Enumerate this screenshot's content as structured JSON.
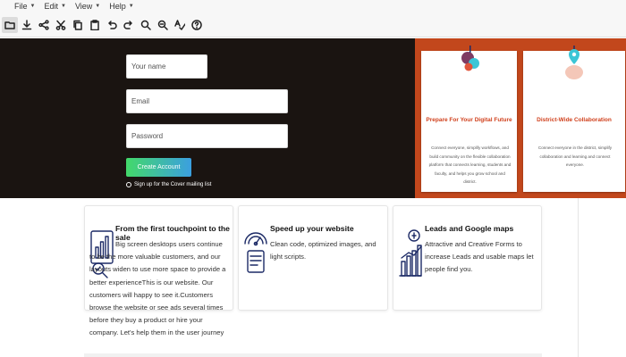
{
  "menubar": {
    "items": [
      {
        "label": "File"
      },
      {
        "label": "Edit"
      },
      {
        "label": "View"
      },
      {
        "label": "Help"
      }
    ]
  },
  "toolbar": {
    "tools": [
      "folder-icon",
      "download-icon",
      "share-icon",
      "cut-icon",
      "copy-icon",
      "paste-icon",
      "undo-icon",
      "redo-icon",
      "zoom-in-icon",
      "zoom-out-icon",
      "spellcheck-icon",
      "help-icon"
    ]
  },
  "form": {
    "name_placeholder": "Your name",
    "email_placeholder": "Email",
    "password_placeholder": "Password",
    "submit_label": "Create Account",
    "mailing_label": "Sign up for the Cover mailing list"
  },
  "promo_cards": [
    {
      "title": "Prepare For Your Digital Future",
      "text": "Connect everyone, simplify workflows, and build community on the flexible collaboration platform that connects learning, students and faculty, and helps you grow school and district."
    },
    {
      "title": "District-Wide Collaboration",
      "text": "Connect everyone in the district, simplify collaboration and learning and connect everyone."
    }
  ],
  "features": [
    {
      "title": "From the first touchpoint to the sale",
      "text": "Big screen desktops users continue to be the more valuable customers, and our layouts widen to use more space to provide a better experienceThis is our website. Our customers will happy to see it.Customers browse the website or see ads several times before they buy a product or hire your company. Let's help them in the user journey"
    },
    {
      "title": "Speed up your website",
      "text": "Clean code, optimized images, and light scripts."
    },
    {
      "title": "Leads and Google maps",
      "text": "Attractive and Creative Forms to increase Leads and usable maps let people find you."
    }
  ],
  "colors": {
    "hero_bg": "#1a1411",
    "orange": "#c2471c",
    "accent_red": "#d0401c",
    "icon_navy": "#1c2a66",
    "button_gradient_start": "#43d96a",
    "button_gradient_end": "#3b9fe0"
  }
}
